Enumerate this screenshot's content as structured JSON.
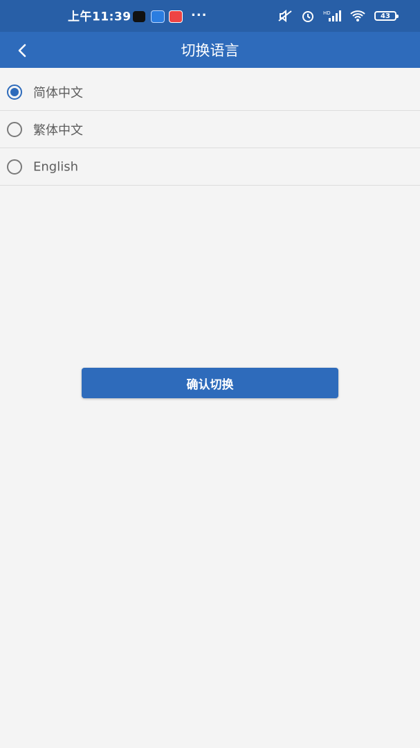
{
  "status_bar": {
    "time": "上午11:39",
    "more": "···",
    "battery": "43",
    "app_icons": [
      "tiktok-icon",
      "cloud-app-icon",
      "ninja-app-icon"
    ],
    "right_icons": [
      "mute-icon",
      "alarm-icon",
      "hd-signal-icon",
      "wifi-icon",
      "battery-icon"
    ]
  },
  "navbar": {
    "title": "切换语言",
    "back_icon": "chevron-left-icon"
  },
  "languages": [
    {
      "label": "简体中文",
      "selected": true
    },
    {
      "label": "繁体中文",
      "selected": false
    },
    {
      "label": "English",
      "selected": false
    }
  ],
  "confirm_button": "确认切换",
  "colors": {
    "primary": "#2e6bbb",
    "status_bar": "#285fa7",
    "background": "#f4f4f4"
  }
}
